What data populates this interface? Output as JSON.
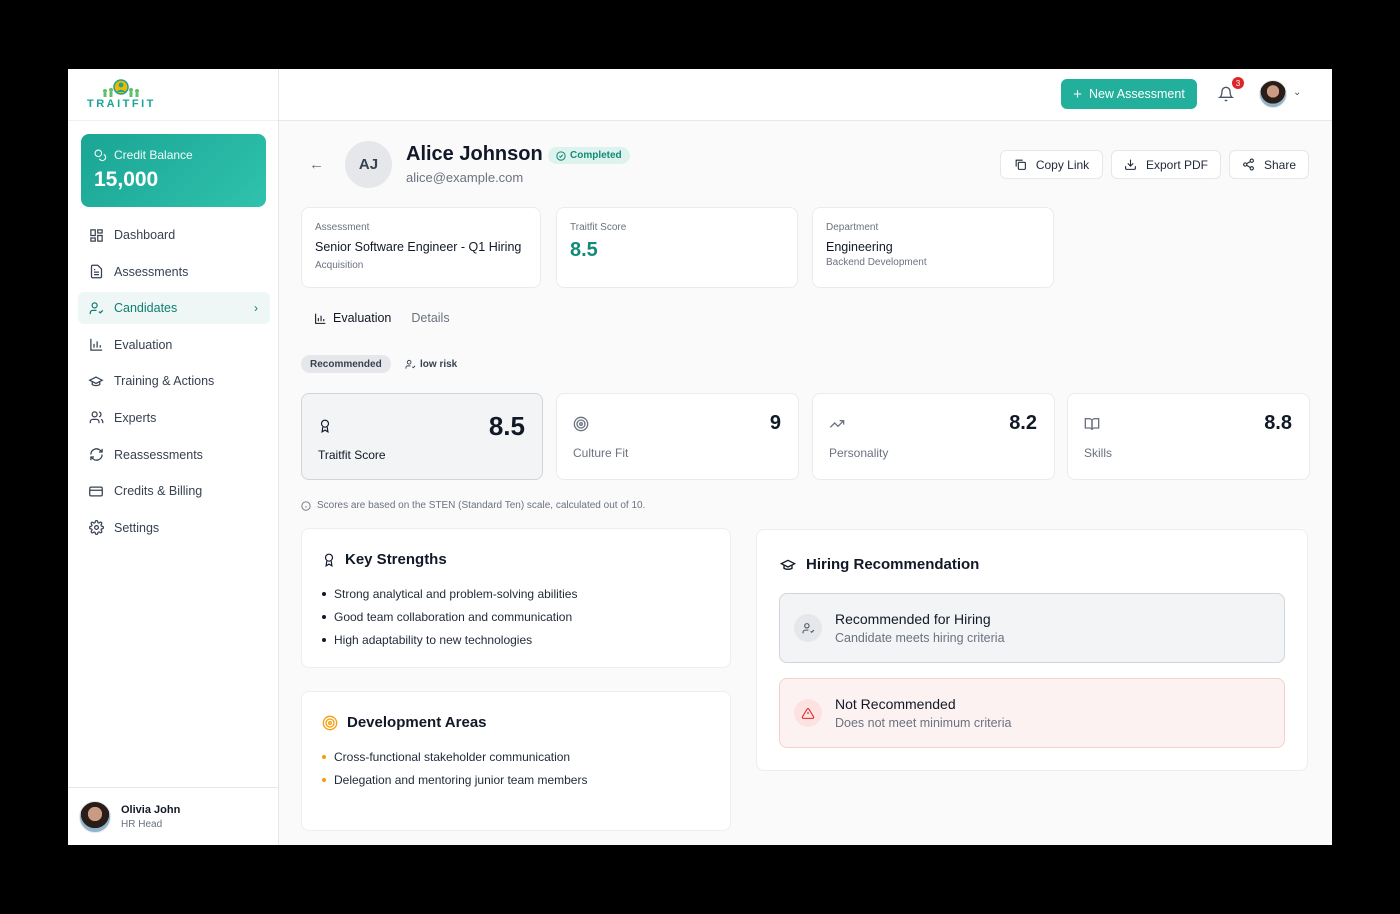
{
  "brand": {
    "logo_text": "TRAITFIT"
  },
  "credit": {
    "label": "Credit Balance",
    "value": "15,000"
  },
  "nav": [
    {
      "label": "Dashboard",
      "icon": "grid-icon"
    },
    {
      "label": "Assessments",
      "icon": "document-icon"
    },
    {
      "label": "Candidates",
      "icon": "user-check-icon"
    },
    {
      "label": "Evaluation",
      "icon": "bar-chart-icon"
    },
    {
      "label": "Training & Actions",
      "icon": "graduation-cap-icon"
    },
    {
      "label": "Experts",
      "icon": "users-icon"
    },
    {
      "label": "Reassessments",
      "icon": "refresh-icon"
    },
    {
      "label": "Credits & Billing",
      "icon": "credit-card-icon"
    },
    {
      "label": "Settings",
      "icon": "gear-icon"
    }
  ],
  "user": {
    "name": "Olivia John",
    "role": "HR Head"
  },
  "topbar": {
    "new_assessment": "New Assessment",
    "notif_count": "3"
  },
  "candidate": {
    "initials": "AJ",
    "name": "Alice Johnson",
    "status": "Completed",
    "email": "alice@example.com"
  },
  "actions": {
    "copy_link": "Copy Link",
    "export_pdf": "Export PDF",
    "share": "Share"
  },
  "info": {
    "assessment": {
      "label": "Assessment",
      "value": "Senior Software Engineer - Q1 Hiring",
      "sub": "Acquisition"
    },
    "score": {
      "label": "Traitfit Score",
      "value": "8.5"
    },
    "department": {
      "label": "Department",
      "value": "Engineering",
      "sub": "Backend Development"
    }
  },
  "tabs": {
    "evaluation": "Evaluation",
    "details": "Details"
  },
  "chips": {
    "recommended": "Recommended",
    "risk": "low risk"
  },
  "scores": [
    {
      "label": "Traitfit Score",
      "value": "8.5"
    },
    {
      "label": "Culture Fit",
      "value": "9"
    },
    {
      "label": "Personality",
      "value": "8.2"
    },
    {
      "label": "Skills",
      "value": "8.8"
    }
  ],
  "note": "Scores are based on the STEN (Standard Ten) scale, calculated out of 10.",
  "strengths": {
    "title": "Key Strengths",
    "items": [
      "Strong analytical and problem-solving abilities",
      "Good team collaboration and communication",
      "High adaptability to new technologies"
    ]
  },
  "development": {
    "title": "Development Areas",
    "items": [
      "Cross-functional stakeholder communication",
      "Delegation and mentoring junior team members"
    ]
  },
  "hiring": {
    "title": "Hiring Recommendation",
    "recommended": {
      "title": "Recommended for Hiring",
      "sub": "Candidate meets hiring criteria"
    },
    "not_recommended": {
      "title": "Not Recommended",
      "sub": "Does not meet minimum criteria"
    }
  },
  "colors": {
    "accent": "#22b09d",
    "accent_dark": "#138a77",
    "danger": "#dc2626",
    "warning": "#f59e0b"
  }
}
